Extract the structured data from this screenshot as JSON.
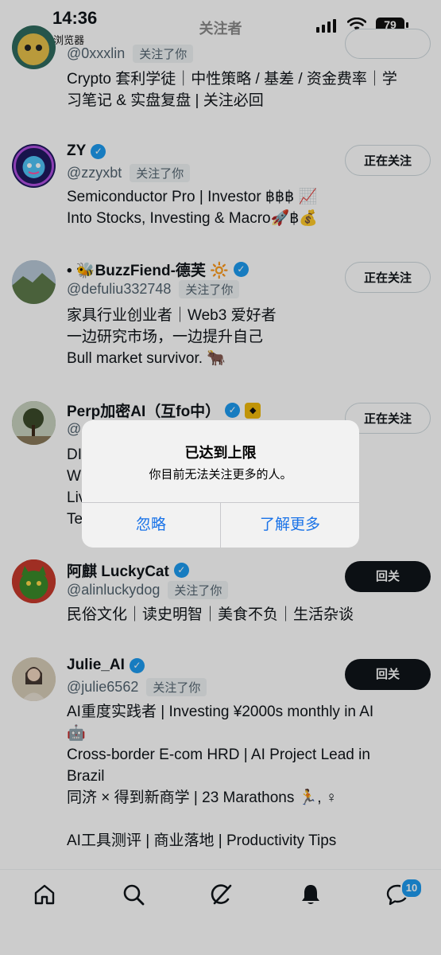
{
  "status": {
    "time": "14:36",
    "back_label": "◀ Safari 浏览器",
    "battery": "79",
    "title": "关注者"
  },
  "rows": [
    {
      "handle": "@0xxxlin",
      "follows_you": "关注了你",
      "bio": [
        "Crypto 套利学徒｜中性策略 / 基差 / 资金费率｜学",
        "习笔记 & 实盘复盘 | 关注必回"
      ]
    },
    {
      "name": "ZY",
      "handle": "@zzyxbt",
      "follows_you": "关注了你",
      "button": "正在关注",
      "bio": [
        "Semiconductor Pro | Investor ฿฿฿ 📈",
        "Into Stocks, Investing & Macro🚀฿💰"
      ]
    },
    {
      "name": "• 🐝BuzzFiend-德芙 🔆",
      "handle": "@defuliu332748",
      "follows_you": "关注了你",
      "button": "正在关注",
      "bio": [
        "家具行业创业者｜Web3 爱好者",
        "一边研究市场，一边提升自己",
        "Bull market survivor. 🐂"
      ]
    },
    {
      "name": "Perp加密AI（互fo中）",
      "handle": "@",
      "button": "正在关注",
      "bio": [
        "DI",
        "W",
        "Liv                                                         i...",
        "Te"
      ]
    },
    {
      "name": "阿麒 LuckyCat",
      "handle": "@alinluckydog",
      "follows_you": "关注了你",
      "button": "回关",
      "bio": [
        "民俗文化｜读史明智｜美食不负｜生活杂谈"
      ]
    },
    {
      "name": "Julie_AI",
      "handle": "@julie6562",
      "follows_you": "关注了你",
      "button": "回关",
      "bio": [
        "AI重度实践者 | Investing ¥2000s monthly in AI",
        "🤖",
        "Cross-border E-com HRD | AI Project Lead in",
        "Brazil",
        "同济 × 得到新商学 | 23 Marathons 🏃, ♀",
        "",
        "AI工具测评 | 商业落地 | Productivity Tips"
      ]
    }
  ],
  "alert": {
    "title": "已达到上限",
    "message": "你目前无法关注更多的人。",
    "dismiss": "忽略",
    "learn_more": "了解更多"
  },
  "tabbar": {
    "items": [
      "home-icon",
      "search-icon",
      "grok-icon",
      "notifications-icon",
      "messages-icon"
    ],
    "messages_badge": "10"
  }
}
